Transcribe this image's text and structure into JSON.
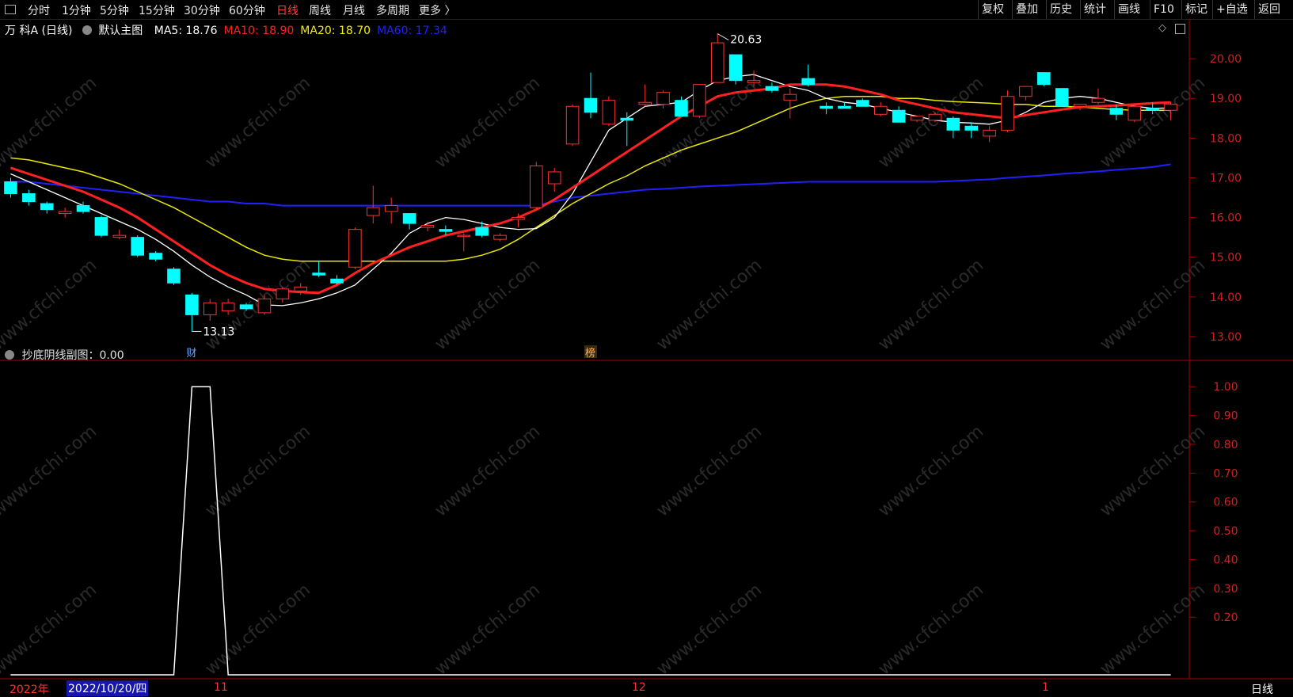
{
  "toolbar": {
    "left": [
      "分时",
      "1分钟",
      "5分钟",
      "15分钟",
      "30分钟",
      "60分钟",
      "日线",
      "周线",
      "月线",
      "多周期",
      "更多 〉"
    ],
    "active_index": 6,
    "right": [
      "复权",
      "叠加",
      "历史",
      "统计",
      "画线",
      "F10",
      "标记",
      "+自选",
      "返回"
    ]
  },
  "main_panel": {
    "stock_name": "万 科A (日线)",
    "template": "默认主图",
    "ma": [
      {
        "label": "MA5: 18.76",
        "color": "#ffffff"
      },
      {
        "label": "MA10: 18.90",
        "color": "#ff2020"
      },
      {
        "label": "MA20: 18.70",
        "color": "#f0f000"
      },
      {
        "label": "MA60: 17.34",
        "color": "#2020ff"
      }
    ],
    "high_label": "20.63",
    "low_label": "13.13",
    "marker_cai": "财",
    "marker_bang": "榜"
  },
  "sub_panel": {
    "title": "抄底阴线副图：0.00"
  },
  "bottom": {
    "year": "2022年",
    "cursor_date": "2022/10/20/四",
    "month_labels": [
      "11",
      "12",
      "1"
    ],
    "period": "日线"
  },
  "watermark": "www.cfchi.com",
  "colors": {
    "up": "#ff3030",
    "down": "#00ffff",
    "ma5": "#ffffff",
    "ma10": "#ff2020",
    "ma20": "#e8e800",
    "ma60": "#2020ff",
    "axis": "#aa0000"
  },
  "chart_data": [
    {
      "type": "candlestick",
      "title": "万 科A (日线)",
      "ylim": [
        12.7,
        20.8
      ],
      "yticks": [
        "20.00",
        "19.00",
        "18.00",
        "17.00",
        "16.00",
        "15.00",
        "14.00",
        "13.00"
      ],
      "candles": [
        [
          16.9,
          17.0,
          16.5,
          16.6
        ],
        [
          16.6,
          16.7,
          16.3,
          16.4
        ],
        [
          16.35,
          16.4,
          16.1,
          16.2
        ],
        [
          16.1,
          16.25,
          16.0,
          16.15
        ],
        [
          16.3,
          16.4,
          16.1,
          16.15
        ],
        [
          16.0,
          16.05,
          15.5,
          15.55
        ],
        [
          15.5,
          15.7,
          15.45,
          15.55
        ],
        [
          15.5,
          15.55,
          15.0,
          15.05
        ],
        [
          15.1,
          15.15,
          14.9,
          14.95
        ],
        [
          14.7,
          14.75,
          14.3,
          14.35
        ],
        [
          14.05,
          14.1,
          13.13,
          13.55
        ],
        [
          13.55,
          13.95,
          13.4,
          13.85
        ],
        [
          13.65,
          13.95,
          13.55,
          13.85
        ],
        [
          13.8,
          13.85,
          13.65,
          13.7
        ],
        [
          13.6,
          14.05,
          13.55,
          13.95
        ],
        [
          13.95,
          14.25,
          13.85,
          14.2
        ],
        [
          14.15,
          14.35,
          14.05,
          14.25
        ],
        [
          14.6,
          14.9,
          14.5,
          14.55
        ],
        [
          14.45,
          14.55,
          14.3,
          14.35
        ],
        [
          14.75,
          15.75,
          14.7,
          15.7
        ],
        [
          16.05,
          16.8,
          15.85,
          16.25
        ],
        [
          16.15,
          16.5,
          15.85,
          16.3
        ],
        [
          16.1,
          16.1,
          15.7,
          15.85
        ],
        [
          15.75,
          15.9,
          15.65,
          15.8
        ],
        [
          15.7,
          15.8,
          15.55,
          15.65
        ],
        [
          15.55,
          15.6,
          15.15,
          15.55
        ],
        [
          15.75,
          15.9,
          15.5,
          15.55
        ],
        [
          15.45,
          15.6,
          15.4,
          15.55
        ],
        [
          15.95,
          16.1,
          15.75,
          16.0
        ],
        [
          16.25,
          17.4,
          16.2,
          17.3
        ],
        [
          16.85,
          17.25,
          16.65,
          17.15
        ],
        [
          17.85,
          18.85,
          17.8,
          18.8
        ],
        [
          19.0,
          19.65,
          18.5,
          18.65
        ],
        [
          18.35,
          19.05,
          18.3,
          18.95
        ],
        [
          18.5,
          18.65,
          17.8,
          18.45
        ],
        [
          18.85,
          19.35,
          18.8,
          18.9
        ],
        [
          18.85,
          19.2,
          18.75,
          19.15
        ],
        [
          18.95,
          19.05,
          18.55,
          18.55
        ],
        [
          18.55,
          19.35,
          18.5,
          19.35
        ],
        [
          19.4,
          20.63,
          19.4,
          20.4
        ],
        [
          20.1,
          20.1,
          19.35,
          19.45
        ],
        [
          19.4,
          19.7,
          19.3,
          19.45
        ],
        [
          19.3,
          19.4,
          19.15,
          19.2
        ],
        [
          18.95,
          19.25,
          18.5,
          19.1
        ],
        [
          19.5,
          19.85,
          19.3,
          19.35
        ],
        [
          18.8,
          18.9,
          18.6,
          18.75
        ],
        [
          18.8,
          18.9,
          18.75,
          18.75
        ],
        [
          18.95,
          19.0,
          18.8,
          18.8
        ],
        [
          18.6,
          18.9,
          18.55,
          18.8
        ],
        [
          18.7,
          18.8,
          18.4,
          18.4
        ],
        [
          18.45,
          18.55,
          18.4,
          18.55
        ],
        [
          18.45,
          18.65,
          18.4,
          18.6
        ],
        [
          18.5,
          18.55,
          18.0,
          18.2
        ],
        [
          18.3,
          18.4,
          18.0,
          18.2
        ],
        [
          18.05,
          18.3,
          17.9,
          18.2
        ],
        [
          18.2,
          19.2,
          18.15,
          19.05
        ],
        [
          19.05,
          19.3,
          18.95,
          19.3
        ],
        [
          19.65,
          19.65,
          19.3,
          19.35
        ],
        [
          19.25,
          19.25,
          18.8,
          18.8
        ],
        [
          18.8,
          18.85,
          18.7,
          18.85
        ],
        [
          18.9,
          19.25,
          18.85,
          19.0
        ],
        [
          18.75,
          18.85,
          18.45,
          18.6
        ],
        [
          18.45,
          18.85,
          18.4,
          18.8
        ],
        [
          18.75,
          18.9,
          18.6,
          18.7
        ],
        [
          18.7,
          18.9,
          18.45,
          18.85
        ]
      ],
      "ma5": [
        17.1,
        16.9,
        16.7,
        16.5,
        16.3,
        16.1,
        15.9,
        15.7,
        15.45,
        15.15,
        14.8,
        14.5,
        14.25,
        14.05,
        13.8,
        13.78,
        13.85,
        13.95,
        14.1,
        14.3,
        14.7,
        15.1,
        15.6,
        15.85,
        16.0,
        15.95,
        15.85,
        15.75,
        15.7,
        15.72,
        16.0,
        16.6,
        17.4,
        18.2,
        18.5,
        18.8,
        18.85,
        18.9,
        19.2,
        19.45,
        19.55,
        19.6,
        19.45,
        19.3,
        19.2,
        19.0,
        18.9,
        18.85,
        18.75,
        18.65,
        18.55,
        18.45,
        18.4,
        18.38,
        18.35,
        18.45,
        18.65,
        18.9,
        19.0,
        19.05,
        19.0,
        18.9,
        18.8,
        18.75,
        18.76
      ],
      "ma10": [
        17.25,
        17.1,
        16.95,
        16.8,
        16.65,
        16.45,
        16.25,
        16.0,
        15.7,
        15.4,
        15.1,
        14.8,
        14.55,
        14.35,
        14.2,
        14.15,
        14.12,
        14.1,
        14.3,
        14.6,
        14.85,
        15.05,
        15.25,
        15.4,
        15.55,
        15.65,
        15.75,
        15.85,
        16.0,
        16.2,
        16.45,
        16.75,
        17.05,
        17.35,
        17.65,
        17.95,
        18.25,
        18.55,
        18.8,
        19.05,
        19.15,
        19.2,
        19.25,
        19.35,
        19.35,
        19.35,
        19.3,
        19.2,
        19.1,
        18.95,
        18.85,
        18.75,
        18.65,
        18.6,
        18.55,
        18.5,
        18.58,
        18.65,
        18.72,
        18.78,
        18.8,
        18.82,
        18.85,
        18.88,
        18.9
      ],
      "ma20": [
        17.5,
        17.45,
        17.35,
        17.25,
        17.15,
        17.0,
        16.85,
        16.65,
        16.45,
        16.25,
        16.0,
        15.75,
        15.5,
        15.25,
        15.05,
        14.95,
        14.9,
        14.9,
        14.9,
        14.9,
        14.9,
        14.9,
        14.9,
        14.9,
        14.9,
        14.95,
        15.05,
        15.2,
        15.45,
        15.75,
        16.05,
        16.35,
        16.6,
        16.85,
        17.05,
        17.3,
        17.5,
        17.7,
        17.85,
        18.0,
        18.15,
        18.35,
        18.55,
        18.75,
        18.9,
        19.0,
        19.05,
        19.05,
        19.05,
        19.0,
        19.0,
        18.95,
        18.92,
        18.9,
        18.88,
        18.85,
        18.85,
        18.8,
        18.8,
        18.78,
        18.75,
        18.72,
        18.7,
        18.7,
        18.7
      ],
      "ma60": [
        16.9,
        16.9,
        16.85,
        16.8,
        16.75,
        16.7,
        16.65,
        16.6,
        16.55,
        16.5,
        16.45,
        16.4,
        16.4,
        16.35,
        16.35,
        16.3,
        16.3,
        16.3,
        16.3,
        16.3,
        16.3,
        16.3,
        16.3,
        16.3,
        16.3,
        16.3,
        16.3,
        16.3,
        16.3,
        16.3,
        16.4,
        16.5,
        16.55,
        16.6,
        16.65,
        16.7,
        16.72,
        16.75,
        16.78,
        16.8,
        16.82,
        16.84,
        16.86,
        16.88,
        16.9,
        16.9,
        16.9,
        16.9,
        16.9,
        16.9,
        16.9,
        16.9,
        16.92,
        16.94,
        16.96,
        17.0,
        17.03,
        17.06,
        17.1,
        17.13,
        17.16,
        17.2,
        17.23,
        17.27,
        17.34
      ]
    },
    {
      "type": "line",
      "title": "抄底阴线副图：0.00",
      "ylim": [
        0,
        1.05
      ],
      "yticks": [
        "1.00",
        "0.90",
        "0.80",
        "0.70",
        "0.60",
        "0.50",
        "0.40",
        "0.30",
        "0.20"
      ],
      "values": [
        0,
        0,
        0,
        0,
        0,
        0,
        0,
        0,
        0,
        0,
        1,
        1,
        0,
        0,
        0,
        0,
        0,
        0,
        0,
        0,
        0,
        0,
        0,
        0,
        0,
        0,
        0,
        0,
        0,
        0,
        0,
        0,
        0,
        0,
        0,
        0,
        0,
        0,
        0,
        0,
        0,
        0,
        0,
        0,
        0,
        0,
        0,
        0,
        0,
        0,
        0,
        0,
        0,
        0,
        0,
        0,
        0,
        0,
        0,
        0,
        0,
        0,
        0,
        0,
        0
      ]
    }
  ]
}
